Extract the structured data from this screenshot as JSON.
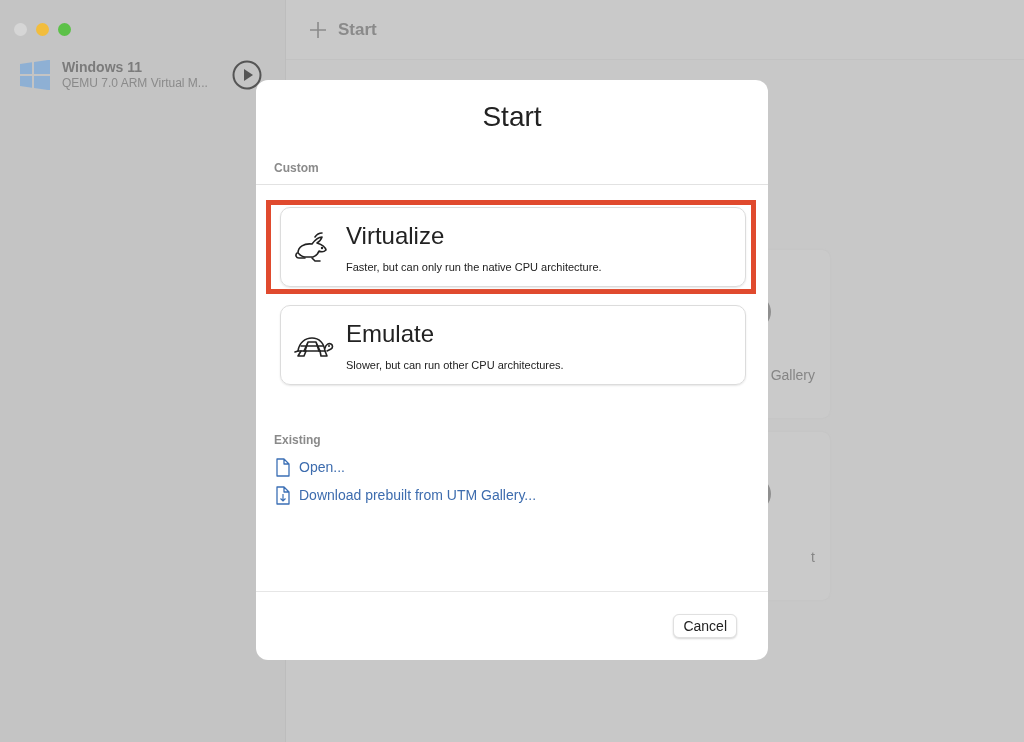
{
  "sidebar": {
    "items": [
      {
        "name": "Windows 11",
        "subtitle": "QEMU 7.0 ARM Virtual M..."
      }
    ]
  },
  "toolbar": {
    "title": "Start"
  },
  "background_cards": [
    {
      "label": "Gallery"
    },
    {
      "label": "t"
    }
  ],
  "dialog": {
    "title": "Start",
    "sections": [
      {
        "heading": "Custom",
        "kind": "options",
        "options": [
          {
            "kind": "rabbit",
            "title": "Virtualize",
            "description": "Faster, but can only run the native CPU architecture.",
            "highlighted": true
          },
          {
            "kind": "turtle",
            "title": "Emulate",
            "description": "Slower, but can run other CPU architectures.",
            "highlighted": false
          }
        ]
      },
      {
        "heading": "Existing",
        "kind": "links",
        "links": [
          {
            "kind": "file",
            "label": "Open..."
          },
          {
            "kind": "download",
            "label": "Download prebuilt from UTM Gallery..."
          }
        ]
      }
    ],
    "buttons": [
      "Cancel"
    ]
  }
}
